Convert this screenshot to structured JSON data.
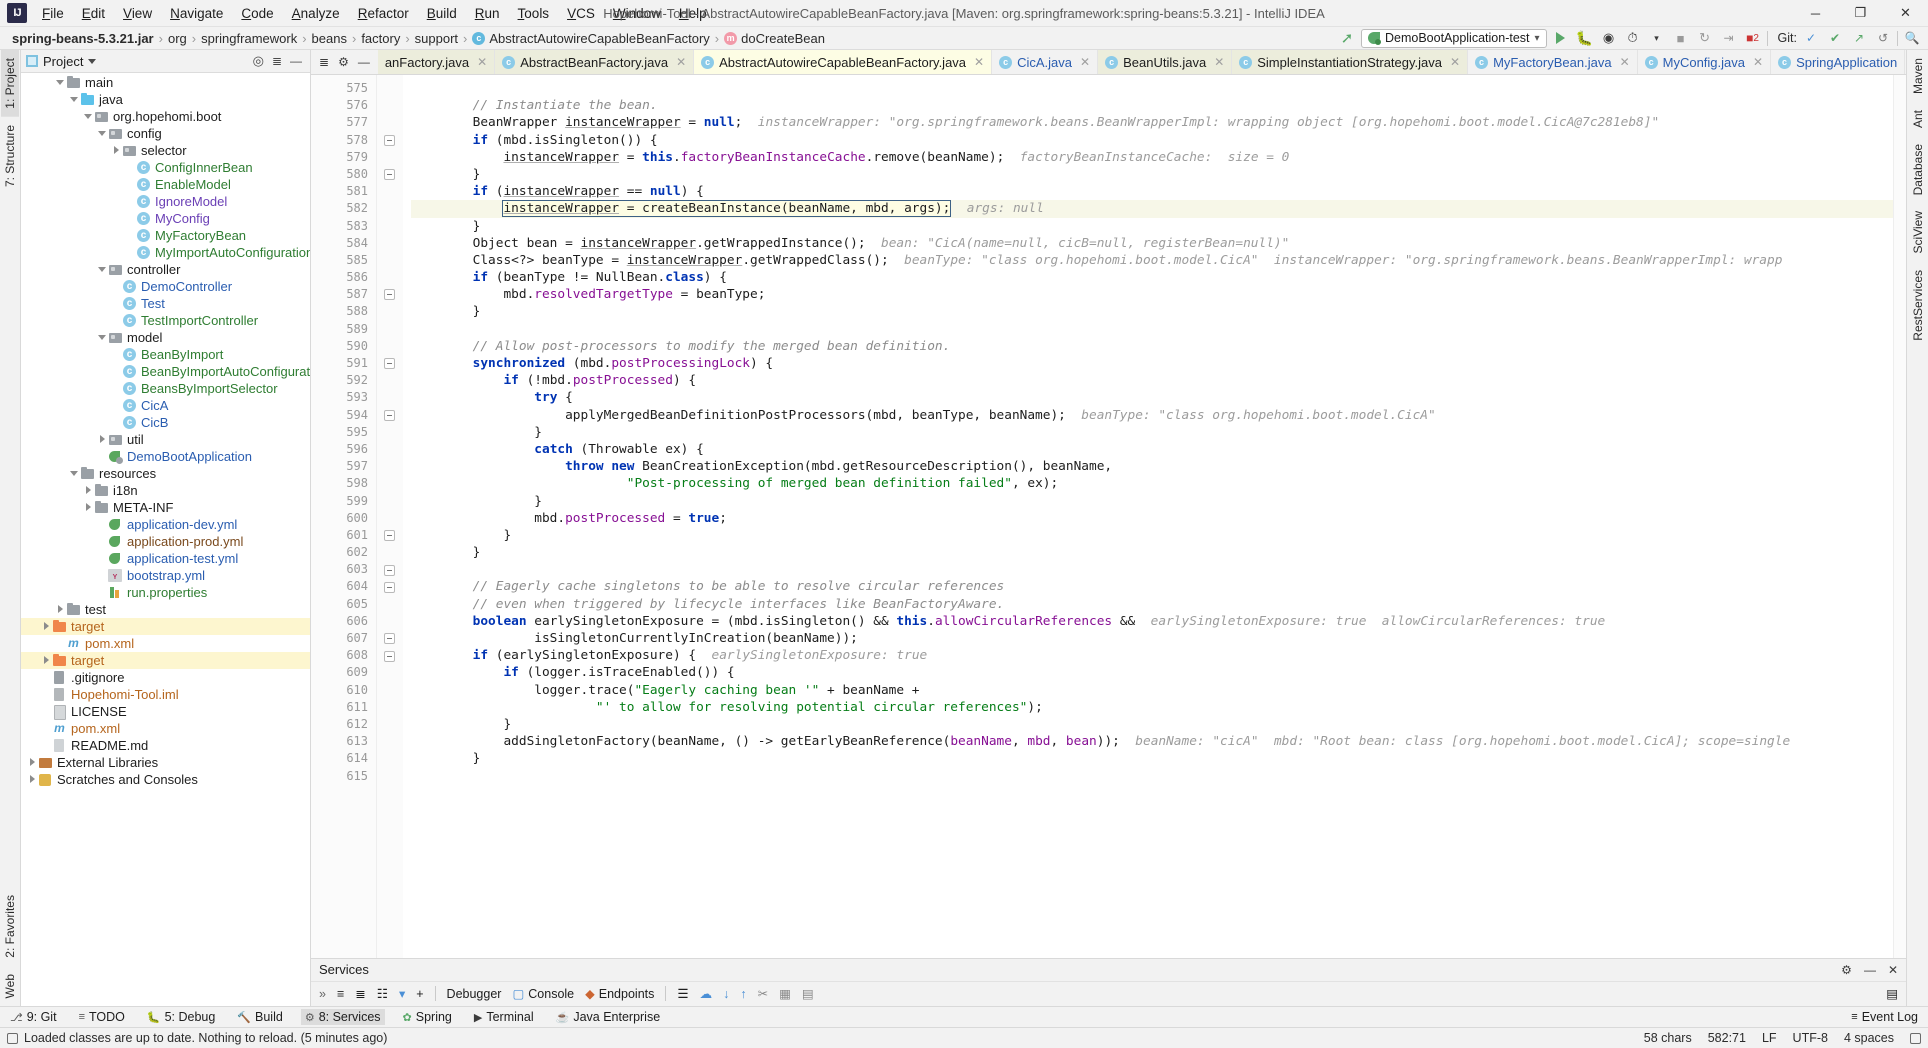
{
  "window": {
    "title": "Hopehomi-Tool - AbstractAutowireCapableBeanFactory.java [Maven: org.springframework:spring-beans:5.3.21] - IntelliJ IDEA",
    "logo": "IJ",
    "minimize": "─",
    "maximize": "❐",
    "close": "✕"
  },
  "menu": [
    "File",
    "Edit",
    "View",
    "Navigate",
    "Code",
    "Analyze",
    "Refactor",
    "Build",
    "Run",
    "Tools",
    "VCS",
    "Window",
    "Help"
  ],
  "breadcrumb": {
    "items": [
      {
        "label": "spring-beans-5.3.21.jar",
        "icon": "",
        "bold": true
      },
      {
        "label": "org",
        "icon": ""
      },
      {
        "label": "springframework",
        "icon": ""
      },
      {
        "label": "beans",
        "icon": ""
      },
      {
        "label": "factory",
        "icon": ""
      },
      {
        "label": "support",
        "icon": ""
      },
      {
        "label": "AbstractAutowireCapableBeanFactory",
        "icon": "class-icon"
      },
      {
        "label": "doCreateBean",
        "icon": "method-icon"
      }
    ],
    "separator": "›"
  },
  "toolbar": {
    "run_config": "DemoBootApplication-test",
    "run_config_icon": "spring-boot-icon",
    "dropdown_arrow": "▾",
    "actions": [
      "run-button",
      "debug-button",
      "run-coverage-button",
      "profiler-button",
      "stop-button",
      "restart-button",
      "step-button",
      "error-badge"
    ],
    "git_label": "Git:",
    "git_actions": [
      "update-project-icon",
      "commit-icon",
      "push-icon",
      "history-icon"
    ],
    "search_icon": "search-icon",
    "hammer_icon": "build-icon",
    "error_count": "2"
  },
  "project_panel": {
    "title": "Project",
    "dropdown": "▾",
    "actions": [
      "locate-icon",
      "collapse-all-icon",
      "hide-icon"
    ],
    "tree": [
      {
        "indent": 2,
        "arrow": "down",
        "icon": "folder",
        "label": "main",
        "color": "dark"
      },
      {
        "indent": 3,
        "arrow": "down",
        "icon": "folder-blue",
        "label": "java",
        "color": "dark"
      },
      {
        "indent": 4,
        "arrow": "down",
        "icon": "package",
        "label": "org.hopehomi.boot",
        "color": "dark"
      },
      {
        "indent": 5,
        "arrow": "down",
        "icon": "package",
        "label": "config",
        "color": "dark"
      },
      {
        "indent": 6,
        "arrow": "right",
        "icon": "package",
        "label": "selector",
        "color": "dark"
      },
      {
        "indent": 7,
        "arrow": "none",
        "icon": "class",
        "label": "ConfigInnerBean",
        "color": "green"
      },
      {
        "indent": 7,
        "arrow": "none",
        "icon": "class",
        "label": "EnableModel",
        "color": "green"
      },
      {
        "indent": 7,
        "arrow": "none",
        "icon": "class",
        "label": "IgnoreModel",
        "color": "purple"
      },
      {
        "indent": 7,
        "arrow": "none",
        "icon": "class",
        "label": "MyConfig",
        "color": "purple"
      },
      {
        "indent": 7,
        "arrow": "none",
        "icon": "class",
        "label": "MyFactoryBean",
        "color": "green"
      },
      {
        "indent": 7,
        "arrow": "none",
        "icon": "class",
        "label": "MyImportAutoConfiguration",
        "color": "green"
      },
      {
        "indent": 5,
        "arrow": "down",
        "icon": "package",
        "label": "controller",
        "color": "dark"
      },
      {
        "indent": 6,
        "arrow": "none",
        "icon": "class",
        "label": "DemoController",
        "color": "blue"
      },
      {
        "indent": 6,
        "arrow": "none",
        "icon": "class",
        "label": "Test",
        "color": "blue"
      },
      {
        "indent": 6,
        "arrow": "none",
        "icon": "class",
        "label": "TestImportController",
        "color": "green"
      },
      {
        "indent": 5,
        "arrow": "down",
        "icon": "package",
        "label": "model",
        "color": "dark"
      },
      {
        "indent": 6,
        "arrow": "none",
        "icon": "class",
        "label": "BeanByImport",
        "color": "green"
      },
      {
        "indent": 6,
        "arrow": "none",
        "icon": "class",
        "label": "BeanByImportAutoConfiguration",
        "color": "green"
      },
      {
        "indent": 6,
        "arrow": "none",
        "icon": "class",
        "label": "BeansByImportSelector",
        "color": "green"
      },
      {
        "indent": 6,
        "arrow": "none",
        "icon": "class",
        "label": "CicA",
        "color": "blue"
      },
      {
        "indent": 6,
        "arrow": "none",
        "icon": "class",
        "label": "CicB",
        "color": "blue"
      },
      {
        "indent": 5,
        "arrow": "right",
        "icon": "package",
        "label": "util",
        "color": "dark"
      },
      {
        "indent": 5,
        "arrow": "none",
        "icon": "spring",
        "label": "DemoBootApplication",
        "color": "blue"
      },
      {
        "indent": 3,
        "arrow": "down",
        "icon": "folder-res",
        "label": "resources",
        "color": "dark"
      },
      {
        "indent": 4,
        "arrow": "right",
        "icon": "folder",
        "label": "i18n",
        "color": "dark"
      },
      {
        "indent": 4,
        "arrow": "right",
        "icon": "folder",
        "label": "META-INF",
        "color": "dark"
      },
      {
        "indent": 5,
        "arrow": "none",
        "icon": "yml",
        "label": "application-dev.yml",
        "color": "blue"
      },
      {
        "indent": 5,
        "arrow": "none",
        "icon": "yml",
        "label": "application-prod.yml",
        "color": "brown"
      },
      {
        "indent": 5,
        "arrow": "none",
        "icon": "yml",
        "label": "application-test.yml",
        "color": "blue"
      },
      {
        "indent": 5,
        "arrow": "none",
        "icon": "yml2",
        "label": "bootstrap.yml",
        "color": "blue"
      },
      {
        "indent": 5,
        "arrow": "none",
        "icon": "props",
        "label": "run.properties",
        "color": "green"
      },
      {
        "indent": 2,
        "arrow": "right",
        "icon": "folder",
        "label": "test",
        "color": "dark"
      },
      {
        "indent": 1,
        "arrow": "right",
        "icon": "folder-orange",
        "label": "target",
        "color": "orange",
        "selected": true
      },
      {
        "indent": 2,
        "arrow": "none",
        "icon": "xml",
        "label": "pom.xml",
        "color": "orange"
      },
      {
        "indent": 1,
        "arrow": "right",
        "icon": "folder-orange",
        "label": "target",
        "color": "orange",
        "selected": true
      },
      {
        "indent": 1,
        "arrow": "none",
        "icon": "git",
        "label": ".gitignore",
        "color": "dark"
      },
      {
        "indent": 1,
        "arrow": "none",
        "icon": "iml",
        "label": "Hopehomi-Tool.iml",
        "color": "orange"
      },
      {
        "indent": 1,
        "arrow": "none",
        "icon": "doc",
        "label": "LICENSE",
        "color": "dark"
      },
      {
        "indent": 1,
        "arrow": "none",
        "icon": "xml",
        "label": "pom.xml",
        "color": "orange"
      },
      {
        "indent": 1,
        "arrow": "none",
        "icon": "md",
        "label": "README.md",
        "color": "dark"
      },
      {
        "indent": 0,
        "arrow": "right",
        "icon": "lib",
        "label": "External Libraries",
        "color": "dark"
      },
      {
        "indent": 0,
        "arrow": "right",
        "icon": "scratch",
        "label": "Scratches and Consoles",
        "color": "dark"
      }
    ]
  },
  "left_strip": [
    {
      "label": "1: Project",
      "active": true,
      "icon": "project-icon"
    },
    {
      "label": "7: Structure",
      "active": false,
      "icon": "structure-icon"
    }
  ],
  "left_strip_bottom": [
    {
      "label": "2: Favorites",
      "icon": "favorites-icon"
    },
    {
      "label": "Web",
      "icon": "web-icon"
    }
  ],
  "right_strip": [
    {
      "label": "Maven",
      "icon": "maven-icon"
    },
    {
      "label": "Ant",
      "icon": "ant-icon"
    },
    {
      "label": "Database",
      "icon": "database-icon"
    },
    {
      "label": "SciView",
      "icon": "sciview-icon"
    },
    {
      "label": "RestServices",
      "icon": "rest-icon"
    }
  ],
  "editor_tabs": [
    {
      "label": "anFactory.java",
      "icon": "",
      "state": "cut",
      "close": "✕"
    },
    {
      "label": "AbstractBeanFactory.java",
      "icon": "class-icon",
      "state": "normal",
      "close": "✕"
    },
    {
      "label": "AbstractAutowireCapableBeanFactory.java",
      "icon": "class-icon",
      "state": "active",
      "close": "✕"
    },
    {
      "label": "CicA.java",
      "icon": "class-icon",
      "state": "plain-blue",
      "close": "✕"
    },
    {
      "label": "BeanUtils.java",
      "icon": "class-icon",
      "state": "normal",
      "close": "✕"
    },
    {
      "label": "SimpleInstantiationStrategy.java",
      "icon": "class-icon",
      "state": "normal",
      "close": "✕"
    },
    {
      "label": "MyFactoryBean.java",
      "icon": "class-icon",
      "state": "plain-blue",
      "close": "✕"
    },
    {
      "label": "MyConfig.java",
      "icon": "class-icon",
      "state": "plain-blue",
      "close": "✕"
    },
    {
      "label": "SpringApplication",
      "icon": "class-icon",
      "state": "plain-blue",
      "close": ""
    }
  ],
  "editor_tab_tools": [
    "collapse-icon",
    "settings-gear-icon",
    "hide-icon"
  ],
  "code": {
    "first_line": 575,
    "lines": [
      {
        "n": 575,
        "html": ""
      },
      {
        "n": 576,
        "html": "        <span class='cmt'>// Instantiate the bean.</span>"
      },
      {
        "n": 577,
        "html": "        BeanWrapper <span class='und'>instanceWrapper</span> = <span class='kw'>null</span>;  <span class='hint'>instanceWrapper: \"org.springframework.beans.BeanWrapperImpl: wrapping object [org.hopehomi.boot.model.CicA@7c281eb8]\"</span>"
      },
      {
        "n": 578,
        "html": "        <span class='kw'>if</span> (mbd.isSingleton()) {"
      },
      {
        "n": 579,
        "html": "            <span class='und'>instanceWrapper</span> = <span class='kw'>this</span>.<span class='fld'>factoryBeanInstanceCache</span>.remove(beanName);  <span class='hint'>factoryBeanInstanceCache:  size = 0</span>"
      },
      {
        "n": 580,
        "html": "        }"
      },
      {
        "n": 581,
        "html": "        <span class='kw'>if</span> (<span class='und'>instanceWrapper</span> == <span class='kw'>null</span>) {"
      },
      {
        "n": 582,
        "html": "            <span class='selbox'><span class='und'>instanceWrapper</span> = createBeanInstance(beanName, mbd, args);</span><span class='caret-bar'></span>  <span class='hint'>args: null</span>",
        "highlight": true
      },
      {
        "n": 583,
        "html": "        }"
      },
      {
        "n": 584,
        "html": "        Object bean = <span class='und'>instanceWrapper</span>.getWrappedInstance();  <span class='hint'>bean: \"CicA(name=null, cicB=null, registerBean=null)\"</span>"
      },
      {
        "n": 585,
        "html": "        Class&lt;?&gt; beanType = <span class='und'>instanceWrapper</span>.getWrappedClass();  <span class='hint'>beanType: \"class org.hopehomi.boot.model.CicA\"  instanceWrapper: \"org.springframework.beans.BeanWrapperImpl: wrapp</span>"
      },
      {
        "n": 586,
        "html": "        <span class='kw'>if</span> (beanType != NullBean.<span class='kw'>class</span>) {"
      },
      {
        "n": 587,
        "html": "            mbd.<span class='fld'>resolvedTargetType</span> = beanType;"
      },
      {
        "n": 588,
        "html": "        }"
      },
      {
        "n": 589,
        "html": ""
      },
      {
        "n": 590,
        "html": "        <span class='cmt'>// Allow post-processors to modify the merged bean definition.</span>"
      },
      {
        "n": 591,
        "html": "        <span class='kw'>synchronized</span> (mbd.<span class='fld'>postProcessingLock</span>) {"
      },
      {
        "n": 592,
        "html": "            <span class='kw'>if</span> (!mbd.<span class='fld'>postProcessed</span>) {"
      },
      {
        "n": 593,
        "html": "                <span class='kw'>try</span> {"
      },
      {
        "n": 594,
        "html": "                    applyMergedBeanDefinitionPostProcessors(mbd, beanType, beanName);  <span class='hint'>beanType: \"class org.hopehomi.boot.model.CicA\"</span>"
      },
      {
        "n": 595,
        "html": "                }"
      },
      {
        "n": 596,
        "html": "                <span class='kw'>catch</span> (Throwable ex) {"
      },
      {
        "n": 597,
        "html": "                    <span class='kw'>throw new</span> BeanCreationException(mbd.getResourceDescription(), beanName,"
      },
      {
        "n": 598,
        "html": "                            <span class='str'>\"Post-processing of merged bean definition failed\"</span>, ex);"
      },
      {
        "n": 599,
        "html": "                }"
      },
      {
        "n": 600,
        "html": "                mbd.<span class='fld'>postProcessed</span> = <span class='kw'>true</span>;"
      },
      {
        "n": 601,
        "html": "            }"
      },
      {
        "n": 602,
        "html": "        }"
      },
      {
        "n": 603,
        "html": ""
      },
      {
        "n": 604,
        "html": "        <span class='cmt'>// Eagerly cache singletons to be able to resolve circular references</span>"
      },
      {
        "n": 605,
        "html": "        <span class='cmt'>// even when triggered by lifecycle interfaces like BeanFactoryAware.</span>"
      },
      {
        "n": 606,
        "html": "        <span class='kw'>boolean</span> earlySingletonExposure = (mbd.isSingleton() &amp;&amp; <span class='kw'>this</span>.<span class='fld'>allowCircularReferences</span> &amp;&amp;  <span class='hint'>earlySingletonExposure: true  allowCircularReferences: true</span>"
      },
      {
        "n": 607,
        "html": "                isSingletonCurrentlyInCreation(beanName));"
      },
      {
        "n": 608,
        "html": "        <span class='kw'>if</span> (earlySingletonExposure) {  <span class='hint'>earlySingletonExposure: true</span>"
      },
      {
        "n": 609,
        "html": "            <span class='kw'>if</span> (logger.isTraceEnabled()) {"
      },
      {
        "n": 610,
        "html": "                logger.trace(<span class='str'>\"Eagerly caching bean '\"</span> + beanName +"
      },
      {
        "n": 611,
        "html": "                        <span class='str'>\"' to allow for resolving potential circular references\"</span>);"
      },
      {
        "n": 612,
        "html": "            }"
      },
      {
        "n": 613,
        "html": "            addSingletonFactory(beanName, () -&gt; getEarlyBeanReference(<span class='fld'>beanName</span>, <span class='fld'>mbd</span>, <span class='fld'>bean</span>));  <span class='hint'>beanName: \"cicA\"  mbd: \"Root bean: class [org.hopehomi.boot.model.CicA]; scope=single</span>"
      },
      {
        "n": 614,
        "html": "        }"
      },
      {
        "n": 615,
        "html": ""
      }
    ]
  },
  "services": {
    "title": "Services",
    "head_actions": [
      "settings-icon",
      "minimize-icon",
      "hide-icon"
    ],
    "toolbar_icons": [
      "expand-icon",
      "collapse-icon",
      "group-icon",
      "filter-icon",
      "add-icon"
    ],
    "items": [
      {
        "label": "Debugger",
        "icon": ""
      },
      {
        "label": "Console",
        "icon": "console-icon"
      },
      {
        "label": "Endpoints",
        "icon": "endpoints-icon"
      }
    ],
    "right_icons": [
      "layout-icon",
      "import-icon",
      "export-icon",
      "upload-icon",
      "scissors-icon",
      "table-icon",
      "grid-icon",
      "print-icon"
    ],
    "more": "»"
  },
  "tool_windows": {
    "left": [
      {
        "label": "9: Git",
        "icon": "git-icon",
        "active": false
      },
      {
        "label": "TODO",
        "icon": "todo-icon",
        "active": false
      },
      {
        "label": "5: Debug",
        "icon": "debug-icon",
        "active": false
      },
      {
        "label": "Build",
        "icon": "build-icon",
        "active": false
      },
      {
        "label": "8: Services",
        "icon": "services-icon",
        "active": true
      },
      {
        "label": "Spring",
        "icon": "spring-icon",
        "active": false
      },
      {
        "label": "Terminal",
        "icon": "terminal-icon",
        "active": false
      },
      {
        "label": "Java Enterprise",
        "icon": "java-enterprise-icon",
        "active": false
      }
    ],
    "right": [
      {
        "label": "Event Log",
        "icon": "event-log-icon"
      }
    ]
  },
  "status_bar": {
    "message": "Loaded classes are up to date. Nothing to reload. (5 minutes ago)",
    "right": [
      {
        "label": "58 chars",
        "name": "char-count"
      },
      {
        "label": "582:71",
        "name": "caret-position"
      },
      {
        "label": "LF",
        "name": "line-separator"
      },
      {
        "label": "UTF-8",
        "name": "encoding"
      },
      {
        "label": "4 spaces",
        "name": "indent"
      },
      {
        "label": "",
        "name": "lock-icon"
      }
    ]
  }
}
